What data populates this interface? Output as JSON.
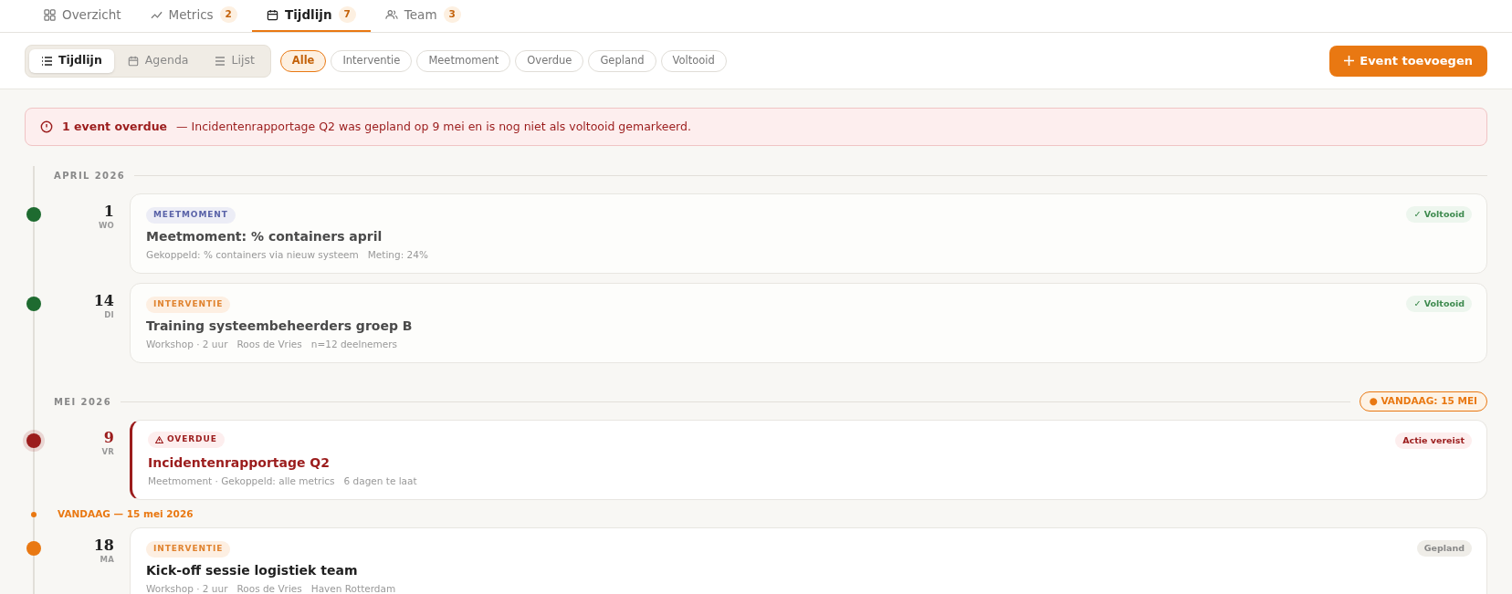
{
  "tabs": [
    {
      "label": "Overzicht",
      "selected": false
    },
    {
      "label": "Metrics",
      "count": "2",
      "selected": false
    },
    {
      "label": "Tijdlijn",
      "count": "7",
      "selected": true
    },
    {
      "label": "Team",
      "count": "3",
      "selected": false
    }
  ],
  "views": [
    {
      "label": "Tijdlijn",
      "selected": true
    },
    {
      "label": "Agenda",
      "selected": false
    },
    {
      "label": "Lijst",
      "selected": false
    }
  ],
  "filters": [
    {
      "label": "Alle",
      "selected": true
    },
    {
      "label": "Interventie",
      "selected": false
    },
    {
      "label": "Meetmoment",
      "selected": false
    },
    {
      "label": "Overdue",
      "selected": false
    },
    {
      "label": "Gepland",
      "selected": false
    },
    {
      "label": "Voltooid",
      "selected": false
    }
  ],
  "add_button": {
    "label": "Event toevoegen"
  },
  "alert": {
    "title": "1 event overdue",
    "message": "— Incidentenrapportage Q2 was gepland op 9 mei en is nog niet als voltooid gemarkeerd."
  },
  "timeline": [
    {
      "kind": "month",
      "label": "APRIL 2026"
    },
    {
      "kind": "event",
      "day": "1",
      "weekday": "WO",
      "tag": {
        "kind": "meetmoment",
        "label": "MEETMOMENT"
      },
      "title": "Meetmoment: % containers april",
      "meta": [
        "Gekoppeld: % containers via nieuw systeem",
        "Meting: 24%"
      ],
      "status": {
        "kind": "done",
        "label": "✓ Voltooid"
      }
    },
    {
      "kind": "event",
      "day": "14",
      "weekday": "DI",
      "tag": {
        "kind": "interventie",
        "label": "INTERVENTIE"
      },
      "title": "Training systeembeheerders groep B",
      "meta": [
        "Workshop · 2 uur",
        "Roos de Vries",
        "n=12 deelnemers"
      ],
      "status": {
        "kind": "done",
        "label": "✓ Voltooid"
      }
    },
    {
      "kind": "month",
      "label": "MEI 2026",
      "badge": "● VANDAAG: 15 MEI"
    },
    {
      "kind": "event",
      "day": "9",
      "weekday": "VR",
      "tag": {
        "kind": "overdue",
        "label": "OVERDUE"
      },
      "title": "Incidentenrapportage Q2",
      "meta": [
        "Meetmoment · Gekoppeld: alle metrics",
        "6 dagen te laat"
      ],
      "status": {
        "kind": "action",
        "label": "Actie vereist"
      }
    },
    {
      "kind": "today",
      "label": "VANDAAG — 15 mei 2026"
    },
    {
      "kind": "event",
      "day": "18",
      "weekday": "MA",
      "tag": {
        "kind": "interventie",
        "label": "INTERVENTIE"
      },
      "title": "Kick-off sessie logistiek team",
      "meta": [
        "Workshop · 2 uur",
        "Roos de Vries",
        "Haven Rotterdam"
      ],
      "status": {
        "kind": "planned",
        "label": "Gepland"
      }
    }
  ]
}
